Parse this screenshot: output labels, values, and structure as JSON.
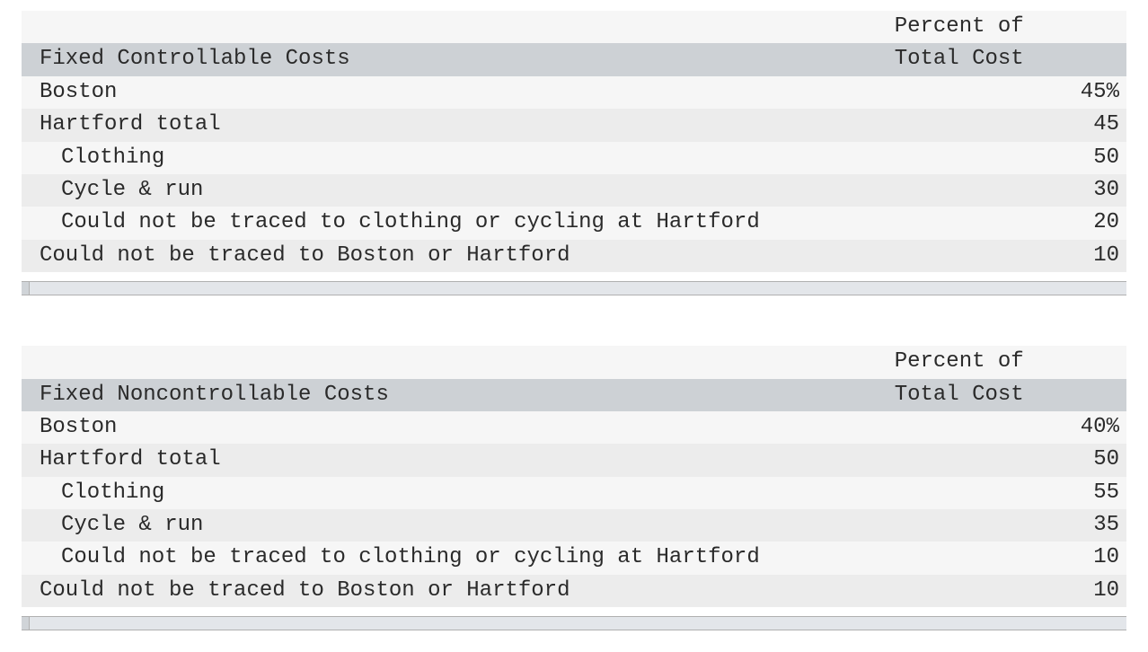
{
  "colors": {
    "header_band": "#cdd1d5",
    "zebra_light": "#f6f6f6",
    "zebra_dark": "#ececec",
    "scrollbar": "#e3e6ea"
  },
  "tables": [
    {
      "id": "controllable",
      "title": "Fixed Controllable Costs",
      "value_header_line1": "Percent of",
      "value_header_line2": "Total Cost",
      "rows": [
        {
          "label": "Boston",
          "value": "45%",
          "indent": 0
        },
        {
          "label": "Hartford total",
          "value": "45",
          "indent": 0
        },
        {
          "label": "Clothing",
          "value": "50",
          "indent": 1
        },
        {
          "label": "Cycle & run",
          "value": "30",
          "indent": 1
        },
        {
          "label": "Could not be traced to clothing or cycling at Hartford",
          "value": "20",
          "indent": 1
        },
        {
          "label": "Could not be traced to Boston or Hartford",
          "value": "10",
          "indent": 0
        }
      ]
    },
    {
      "id": "noncontrollable",
      "title": "Fixed Noncontrollable Costs",
      "value_header_line1": "Percent of",
      "value_header_line2": "Total Cost",
      "rows": [
        {
          "label": "Boston",
          "value": "40%",
          "indent": 0
        },
        {
          "label": "Hartford total",
          "value": "50",
          "indent": 0
        },
        {
          "label": "Clothing",
          "value": "55",
          "indent": 1
        },
        {
          "label": "Cycle & run",
          "value": "35",
          "indent": 1
        },
        {
          "label": "Could not be traced to clothing or cycling at Hartford",
          "value": "10",
          "indent": 1
        },
        {
          "label": "Could not be traced to Boston or Hartford",
          "value": "10",
          "indent": 0
        }
      ]
    }
  ]
}
